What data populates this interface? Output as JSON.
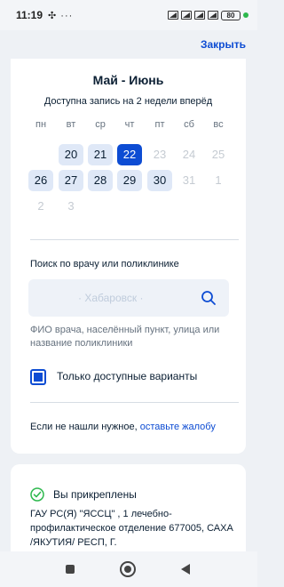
{
  "status_bar": {
    "time": "11:19",
    "left_icons": "✣ ···",
    "battery": "80"
  },
  "header": {
    "close_label": "Закрыть"
  },
  "calendar": {
    "title": "Май - Июнь",
    "subtitle": "Доступна запись на 2 недели вперёд",
    "weekdays": [
      "пн",
      "вт",
      "ср",
      "чт",
      "пт",
      "сб",
      "вс"
    ],
    "rows": [
      [
        {
          "d": "",
          "s": "empty"
        },
        {
          "d": "20",
          "s": "available"
        },
        {
          "d": "21",
          "s": "available"
        },
        {
          "d": "22",
          "s": "selected"
        },
        {
          "d": "23",
          "s": "disabled"
        },
        {
          "d": "24",
          "s": "disabled"
        },
        {
          "d": "25",
          "s": "disabled"
        }
      ],
      [
        {
          "d": "26",
          "s": "available"
        },
        {
          "d": "27",
          "s": "available"
        },
        {
          "d": "28",
          "s": "available"
        },
        {
          "d": "29",
          "s": "available"
        },
        {
          "d": "30",
          "s": "available"
        },
        {
          "d": "31",
          "s": "disabled"
        },
        {
          "d": "1",
          "s": "disabled"
        }
      ],
      [
        {
          "d": "2",
          "s": "disabled"
        },
        {
          "d": "3",
          "s": "disabled"
        }
      ]
    ]
  },
  "search": {
    "label": "Поиск по врачу или поликлинике",
    "placeholder": "· Хабаровск ·",
    "hint": "ФИО врача, населённый пункт, улица или название поликлиники"
  },
  "filter": {
    "label": "Только доступные варианты",
    "checked": true
  },
  "complaint": {
    "prefix": "Если не нашли нужное, ",
    "link": "оставьте жалобу"
  },
  "attached": {
    "title": "Вы прикреплены",
    "org": "ГАУ РС(Я) \"ЯССЦ\" , 1 лечебно-профилактическое отделение 677005, САХА /ЯКУТИЯ/ РЕСП, Г."
  },
  "colors": {
    "accent": "#0d4cd3",
    "available_bg": "#dfe8f7",
    "success": "#2db84d"
  },
  "icons": {
    "search": "search-icon",
    "attached": "check-circle-icon",
    "nav_recent": "square-icon",
    "nav_home": "circle-icon",
    "nav_back": "triangle-back-icon"
  }
}
